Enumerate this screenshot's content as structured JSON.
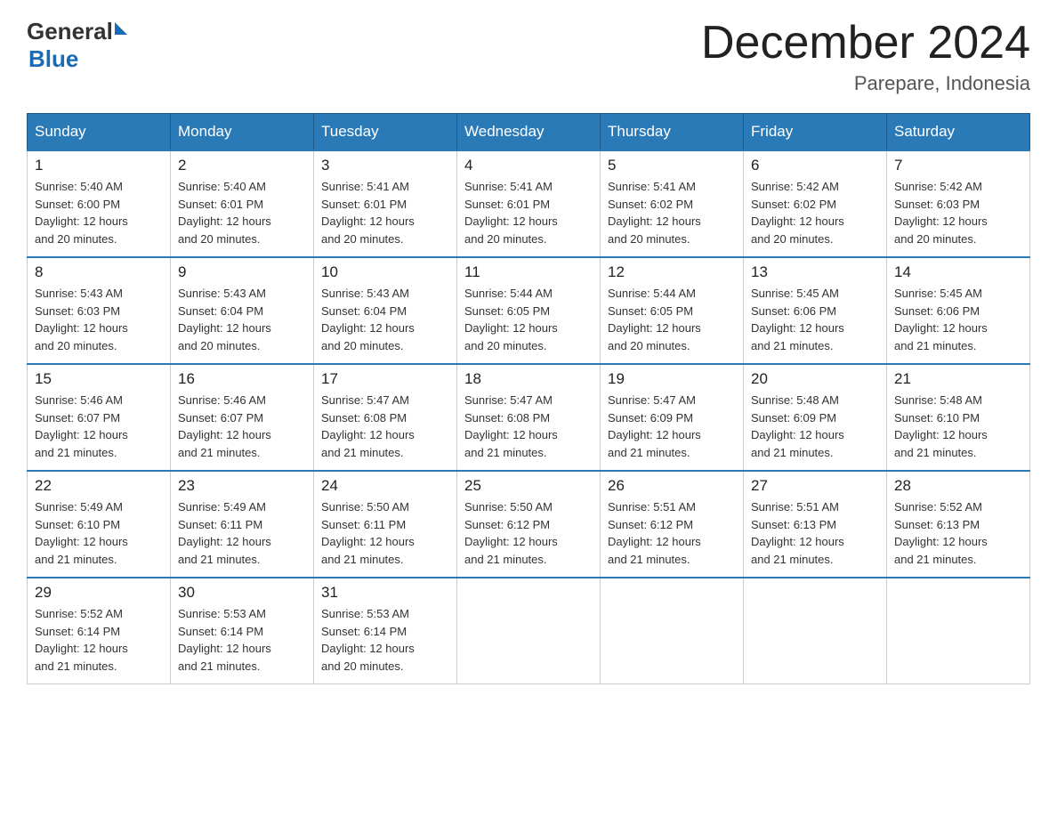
{
  "logo": {
    "text_general": "General",
    "triangle": "▶",
    "text_blue": "Blue"
  },
  "title": "December 2024",
  "subtitle": "Parepare, Indonesia",
  "days_of_week": [
    "Sunday",
    "Monday",
    "Tuesday",
    "Wednesday",
    "Thursday",
    "Friday",
    "Saturday"
  ],
  "weeks": [
    [
      {
        "day": "1",
        "sunrise": "5:40 AM",
        "sunset": "6:00 PM",
        "daylight": "12 hours and 20 minutes."
      },
      {
        "day": "2",
        "sunrise": "5:40 AM",
        "sunset": "6:01 PM",
        "daylight": "12 hours and 20 minutes."
      },
      {
        "day": "3",
        "sunrise": "5:41 AM",
        "sunset": "6:01 PM",
        "daylight": "12 hours and 20 minutes."
      },
      {
        "day": "4",
        "sunrise": "5:41 AM",
        "sunset": "6:01 PM",
        "daylight": "12 hours and 20 minutes."
      },
      {
        "day": "5",
        "sunrise": "5:41 AM",
        "sunset": "6:02 PM",
        "daylight": "12 hours and 20 minutes."
      },
      {
        "day": "6",
        "sunrise": "5:42 AM",
        "sunset": "6:02 PM",
        "daylight": "12 hours and 20 minutes."
      },
      {
        "day": "7",
        "sunrise": "5:42 AM",
        "sunset": "6:03 PM",
        "daylight": "12 hours and 20 minutes."
      }
    ],
    [
      {
        "day": "8",
        "sunrise": "5:43 AM",
        "sunset": "6:03 PM",
        "daylight": "12 hours and 20 minutes."
      },
      {
        "day": "9",
        "sunrise": "5:43 AM",
        "sunset": "6:04 PM",
        "daylight": "12 hours and 20 minutes."
      },
      {
        "day": "10",
        "sunrise": "5:43 AM",
        "sunset": "6:04 PM",
        "daylight": "12 hours and 20 minutes."
      },
      {
        "day": "11",
        "sunrise": "5:44 AM",
        "sunset": "6:05 PM",
        "daylight": "12 hours and 20 minutes."
      },
      {
        "day": "12",
        "sunrise": "5:44 AM",
        "sunset": "6:05 PM",
        "daylight": "12 hours and 20 minutes."
      },
      {
        "day": "13",
        "sunrise": "5:45 AM",
        "sunset": "6:06 PM",
        "daylight": "12 hours and 21 minutes."
      },
      {
        "day": "14",
        "sunrise": "5:45 AM",
        "sunset": "6:06 PM",
        "daylight": "12 hours and 21 minutes."
      }
    ],
    [
      {
        "day": "15",
        "sunrise": "5:46 AM",
        "sunset": "6:07 PM",
        "daylight": "12 hours and 21 minutes."
      },
      {
        "day": "16",
        "sunrise": "5:46 AM",
        "sunset": "6:07 PM",
        "daylight": "12 hours and 21 minutes."
      },
      {
        "day": "17",
        "sunrise": "5:47 AM",
        "sunset": "6:08 PM",
        "daylight": "12 hours and 21 minutes."
      },
      {
        "day": "18",
        "sunrise": "5:47 AM",
        "sunset": "6:08 PM",
        "daylight": "12 hours and 21 minutes."
      },
      {
        "day": "19",
        "sunrise": "5:47 AM",
        "sunset": "6:09 PM",
        "daylight": "12 hours and 21 minutes."
      },
      {
        "day": "20",
        "sunrise": "5:48 AM",
        "sunset": "6:09 PM",
        "daylight": "12 hours and 21 minutes."
      },
      {
        "day": "21",
        "sunrise": "5:48 AM",
        "sunset": "6:10 PM",
        "daylight": "12 hours and 21 minutes."
      }
    ],
    [
      {
        "day": "22",
        "sunrise": "5:49 AM",
        "sunset": "6:10 PM",
        "daylight": "12 hours and 21 minutes."
      },
      {
        "day": "23",
        "sunrise": "5:49 AM",
        "sunset": "6:11 PM",
        "daylight": "12 hours and 21 minutes."
      },
      {
        "day": "24",
        "sunrise": "5:50 AM",
        "sunset": "6:11 PM",
        "daylight": "12 hours and 21 minutes."
      },
      {
        "day": "25",
        "sunrise": "5:50 AM",
        "sunset": "6:12 PM",
        "daylight": "12 hours and 21 minutes."
      },
      {
        "day": "26",
        "sunrise": "5:51 AM",
        "sunset": "6:12 PM",
        "daylight": "12 hours and 21 minutes."
      },
      {
        "day": "27",
        "sunrise": "5:51 AM",
        "sunset": "6:13 PM",
        "daylight": "12 hours and 21 minutes."
      },
      {
        "day": "28",
        "sunrise": "5:52 AM",
        "sunset": "6:13 PM",
        "daylight": "12 hours and 21 minutes."
      }
    ],
    [
      {
        "day": "29",
        "sunrise": "5:52 AM",
        "sunset": "6:14 PM",
        "daylight": "12 hours and 21 minutes."
      },
      {
        "day": "30",
        "sunrise": "5:53 AM",
        "sunset": "6:14 PM",
        "daylight": "12 hours and 21 minutes."
      },
      {
        "day": "31",
        "sunrise": "5:53 AM",
        "sunset": "6:14 PM",
        "daylight": "12 hours and 20 minutes."
      },
      null,
      null,
      null,
      null
    ]
  ],
  "labels": {
    "sunrise": "Sunrise:",
    "sunset": "Sunset:",
    "daylight": "Daylight:"
  }
}
